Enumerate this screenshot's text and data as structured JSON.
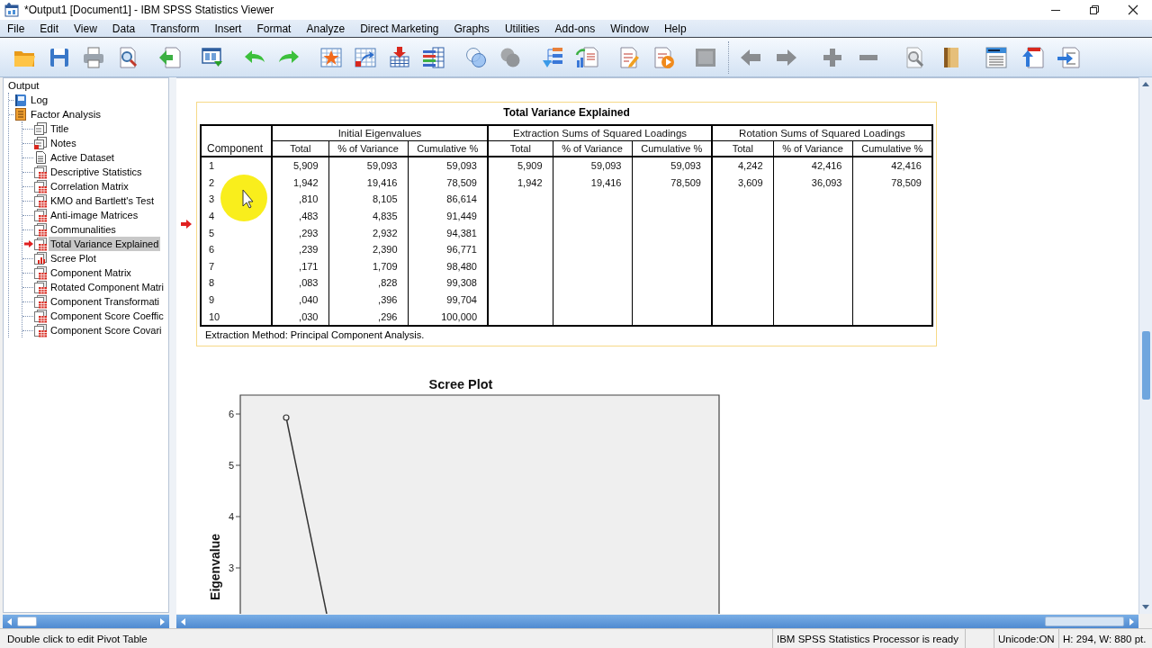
{
  "window": {
    "title": "*Output1 [Document1] - IBM SPSS Statistics Viewer"
  },
  "menu": [
    "File",
    "Edit",
    "View",
    "Data",
    "Transform",
    "Insert",
    "Format",
    "Analyze",
    "Direct Marketing",
    "Graphs",
    "Utilities",
    "Add-ons",
    "Window",
    "Help"
  ],
  "toolbar": [
    {
      "groups": [
        [
          {
            "kind": "open",
            "disabled": false
          },
          {
            "kind": "save",
            "disabled": false
          },
          {
            "kind": "print",
            "disabled": false
          },
          {
            "kind": "preview",
            "disabled": false
          }
        ],
        [
          {
            "kind": "export",
            "disabled": false
          }
        ],
        [
          {
            "kind": "recall",
            "disabled": false
          }
        ],
        [
          {
            "kind": "undo",
            "disabled": false
          },
          {
            "kind": "redo",
            "disabled": false
          }
        ],
        [
          {
            "kind": "data",
            "disabled": false
          },
          {
            "kind": "case",
            "disabled": false
          },
          {
            "kind": "variable",
            "disabled": false
          },
          {
            "kind": "variables",
            "disabled": false
          }
        ],
        [
          {
            "kind": "sets",
            "disabled": false
          },
          {
            "kind": "showall",
            "disabled": true
          }
        ],
        [
          {
            "kind": "designate",
            "disabled": false
          },
          {
            "kind": "insert",
            "disabled": false
          }
        ],
        [
          {
            "kind": "edit",
            "disabled": false
          },
          {
            "kind": "run",
            "disabled": false
          }
        ],
        [
          {
            "kind": "blank",
            "disabled": true
          }
        ]
      ]
    },
    {
      "groups": [
        [
          {
            "kind": "back",
            "disabled": true
          },
          {
            "kind": "forward",
            "disabled": true
          }
        ],
        [
          {
            "kind": "expand",
            "disabled": true
          },
          {
            "kind": "collapse",
            "disabled": true
          }
        ],
        [
          {
            "kind": "hide",
            "disabled": true
          },
          {
            "kind": "book",
            "disabled": false
          }
        ],
        [
          {
            "kind": "heading",
            "disabled": false
          },
          {
            "kind": "promote",
            "disabled": false
          },
          {
            "kind": "demote",
            "disabled": false
          }
        ]
      ]
    }
  ],
  "outline": {
    "label": "Output",
    "selected": false,
    "children": [
      {
        "label": "Log",
        "kind": "log",
        "selected": false
      },
      {
        "label": "Factor Analysis",
        "kind": "heading",
        "selected": false,
        "children": [
          {
            "label": "Title",
            "kind": "title",
            "selected": false
          },
          {
            "label": "Notes",
            "kind": "notes",
            "selected": false
          },
          {
            "label": "Active Dataset",
            "kind": "text",
            "selected": false
          },
          {
            "label": "Descriptive Statistics",
            "kind": "table",
            "selected": false
          },
          {
            "label": "Correlation Matrix",
            "kind": "table",
            "selected": false
          },
          {
            "label": "KMO and Bartlett's Test",
            "kind": "table",
            "selected": false
          },
          {
            "label": "Anti-image Matrices",
            "kind": "table",
            "selected": false
          },
          {
            "label": "Communalities",
            "kind": "table",
            "selected": false
          },
          {
            "label": "Total Variance Explained",
            "kind": "table",
            "selected": true
          },
          {
            "label": "Scree Plot",
            "kind": "chart",
            "selected": false
          },
          {
            "label": "Component Matrix",
            "kind": "table",
            "selected": false
          },
          {
            "label": "Rotated Component Matri",
            "kind": "table",
            "selected": false
          },
          {
            "label": "Component Transformati",
            "kind": "table",
            "selected": false
          },
          {
            "label": "Component Score Coeffic",
            "kind": "table",
            "selected": false
          },
          {
            "label": "Component Score Covari",
            "kind": "table",
            "selected": false
          }
        ]
      }
    ]
  },
  "viewer": {
    "table": {
      "title": "Total Variance Explained",
      "selected": true,
      "stub_heading": "Component",
      "groups": [
        {
          "label": "Initial Eigenvalues",
          "columns": [
            "Total",
            "% of Variance",
            "Cumulative %"
          ]
        },
        {
          "label": "Extraction Sums of Squared Loadings",
          "columns": [
            "Total",
            "% of Variance",
            "Cumulative %"
          ]
        },
        {
          "label": "Rotation Sums of Squared Loadings",
          "columns": [
            "Total",
            "% of Variance",
            "Cumulative %"
          ]
        }
      ],
      "rows": [
        {
          "component": "1",
          "cells": [
            "5,909",
            "59,093",
            "59,093",
            "5,909",
            "59,093",
            "59,093",
            "4,242",
            "42,416",
            "42,416"
          ]
        },
        {
          "component": "2",
          "cells": [
            "1,942",
            "19,416",
            "78,509",
            "1,942",
            "19,416",
            "78,509",
            "3,609",
            "36,093",
            "78,509"
          ]
        },
        {
          "component": "3",
          "cells": [
            ",810",
            "8,105",
            "86,614"
          ]
        },
        {
          "component": "4",
          "cells": [
            ",483",
            "4,835",
            "91,449"
          ]
        },
        {
          "component": "5",
          "cells": [
            ",293",
            "2,932",
            "94,381"
          ]
        },
        {
          "component": "6",
          "cells": [
            ",239",
            "2,390",
            "96,771"
          ]
        },
        {
          "component": "7",
          "cells": [
            ",171",
            "1,709",
            "98,480"
          ]
        },
        {
          "component": "8",
          "cells": [
            ",083",
            ",828",
            "99,308"
          ]
        },
        {
          "component": "9",
          "cells": [
            ",040",
            ",396",
            "99,704"
          ]
        },
        {
          "component": "10",
          "cells": [
            ",030",
            ",296",
            "100,000"
          ]
        }
      ],
      "footnote": "Extraction Method: Principal Component Analysis."
    },
    "chart": {
      "title": "Scree Plot",
      "ylabel": "Eigenvalue",
      "y_tick_labels": [
        "6",
        "5",
        "4",
        "3"
      ]
    }
  },
  "status_bar": {
    "message": "Double click to edit Pivot Table",
    "processor": "IBM SPSS Statistics Processor is ready",
    "unicode": "Unicode:ON",
    "size": "H: 294, W: 880 pt."
  }
}
